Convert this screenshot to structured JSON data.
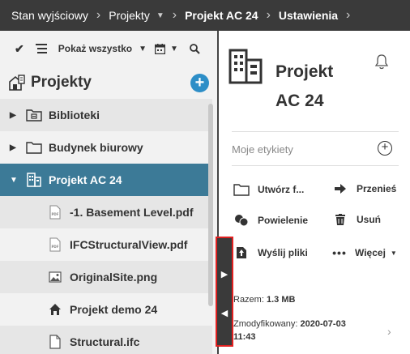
{
  "breadcrumb": {
    "items": [
      "Stan wyjściowy",
      "Projekty",
      "Projekt AC 24",
      "Ustawienia"
    ]
  },
  "toolbar": {
    "filter_label": "Pokaż wszystko"
  },
  "left_panel": {
    "title": "Projekty",
    "tree": [
      {
        "label": "Biblioteki",
        "icon": "library-folder-icon"
      },
      {
        "label": "Budynek biurowy",
        "icon": "folder-icon"
      },
      {
        "label": "Projekt AC 24",
        "icon": "building-icon",
        "selected": true
      },
      {
        "label": "-1. Basement Level.pdf",
        "icon": "pdf-file-icon"
      },
      {
        "label": "IFCStructuralView.pdf",
        "icon": "pdf-file-icon"
      },
      {
        "label": "OriginalSite.png",
        "icon": "image-file-icon"
      },
      {
        "label": "Projekt demo 24",
        "icon": "house-icon"
      },
      {
        "label": "Structural.ifc",
        "icon": "file-icon"
      }
    ]
  },
  "right_panel": {
    "title_line1": "Projekt",
    "title_line2": "AC 24",
    "tags_placeholder": "Moje etykiety",
    "actions": {
      "create": "Utwórz f...",
      "move": "Przenieś",
      "duplicate": "Powielenie",
      "delete": "Usuń",
      "send": "Wyślij pliki",
      "more": "Więcej"
    },
    "total_label": "Razem:",
    "total_value": "1.3 MB",
    "modified_label": "Zmodyfikowany:",
    "modified_date": "2020-07-03",
    "modified_time": "11:43"
  },
  "colors": {
    "topbar": "#3a3a3a",
    "selected_row": "#3c7a97",
    "accent": "#2d8ec7",
    "highlight_border": "#e02020"
  }
}
